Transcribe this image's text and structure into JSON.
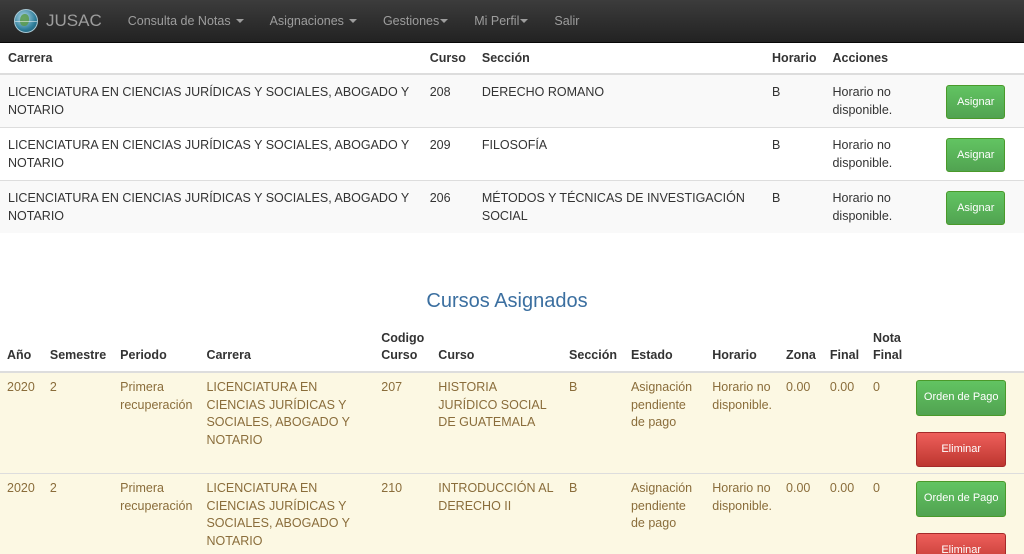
{
  "nav": {
    "brand": "JUSAC",
    "items": [
      {
        "label": "Consulta de Notas",
        "caret": true
      },
      {
        "label": "Asignaciones",
        "caret": true
      },
      {
        "label": "Gestiones",
        "caret": true
      },
      {
        "label": "Mi Perfil",
        "caret": true
      },
      {
        "label": "Salir",
        "caret": false
      }
    ]
  },
  "available": {
    "headers": {
      "carrera": "Carrera",
      "curso": "Curso",
      "seccion": "Sección",
      "horario": "Horario",
      "acciones": "Acciones"
    },
    "rows": [
      {
        "carrera": "LICENCIATURA EN CIENCIAS JURÍDICAS Y SOCIALES, ABOGADO Y NOTARIO",
        "curso": "208",
        "seccion": "DERECHO ROMANO",
        "horario": "B",
        "acciones": "Horario no disponible.",
        "button": "Asignar"
      },
      {
        "carrera": "LICENCIATURA EN CIENCIAS JURÍDICAS Y SOCIALES, ABOGADO Y NOTARIO",
        "curso": "209",
        "seccion": "FILOSOFÍA",
        "horario": "B",
        "acciones": "Horario no disponible.",
        "button": "Asignar"
      },
      {
        "carrera": "LICENCIATURA EN CIENCIAS JURÍDICAS Y SOCIALES, ABOGADO Y NOTARIO",
        "curso": "206",
        "seccion": "MÉTODOS Y TÉCNICAS DE INVESTIGACIÓN SOCIAL",
        "horario": "B",
        "acciones": "Horario no disponible.",
        "button": "Asignar"
      }
    ]
  },
  "assigned": {
    "title": "Cursos Asignados",
    "headers": {
      "anio": "Año",
      "semestre": "Semestre",
      "periodo": "Periodo",
      "carrera": "Carrera",
      "codigo": "Codigo Curso",
      "curso": "Curso",
      "seccion": "Sección",
      "estado": "Estado",
      "horario": "Horario",
      "zona": "Zona",
      "final": "Final",
      "nota_final": "Nota Final"
    },
    "rows": [
      {
        "anio": "2020",
        "semestre": "2",
        "periodo": "Primera recuperación",
        "carrera": "LICENCIATURA EN CIENCIAS JURÍDICAS Y SOCIALES, ABOGADO Y NOTARIO",
        "codigo": "207",
        "curso": "HISTORIA JURÍDICO SOCIAL DE GUATEMALA",
        "seccion": "B",
        "estado": "Asignación pendiente de pago",
        "horario": "Horario no disponible.",
        "zona": "0.00",
        "final": "0.00",
        "nota_final": "0",
        "pay_button": "Orden de Pago",
        "delete_button": "Eliminar"
      },
      {
        "anio": "2020",
        "semestre": "2",
        "periodo": "Primera recuperación",
        "carrera": "LICENCIATURA EN CIENCIAS JURÍDICAS Y SOCIALES, ABOGADO Y NOTARIO",
        "codigo": "210",
        "curso": "INTRODUCCIÓN AL DERECHO II",
        "seccion": "B",
        "estado": "Asignación pendiente de pago",
        "horario": "Horario no disponible.",
        "zona": "0.00",
        "final": "0.00",
        "nota_final": "0",
        "pay_button": "Orden de Pago",
        "delete_button": "Eliminar"
      }
    ]
  },
  "colors": {
    "navbar": "#222222",
    "success": "#5bb75b",
    "danger": "#da4f49",
    "warning_row": "#fcf8e3",
    "title": "#3b6fa0"
  }
}
